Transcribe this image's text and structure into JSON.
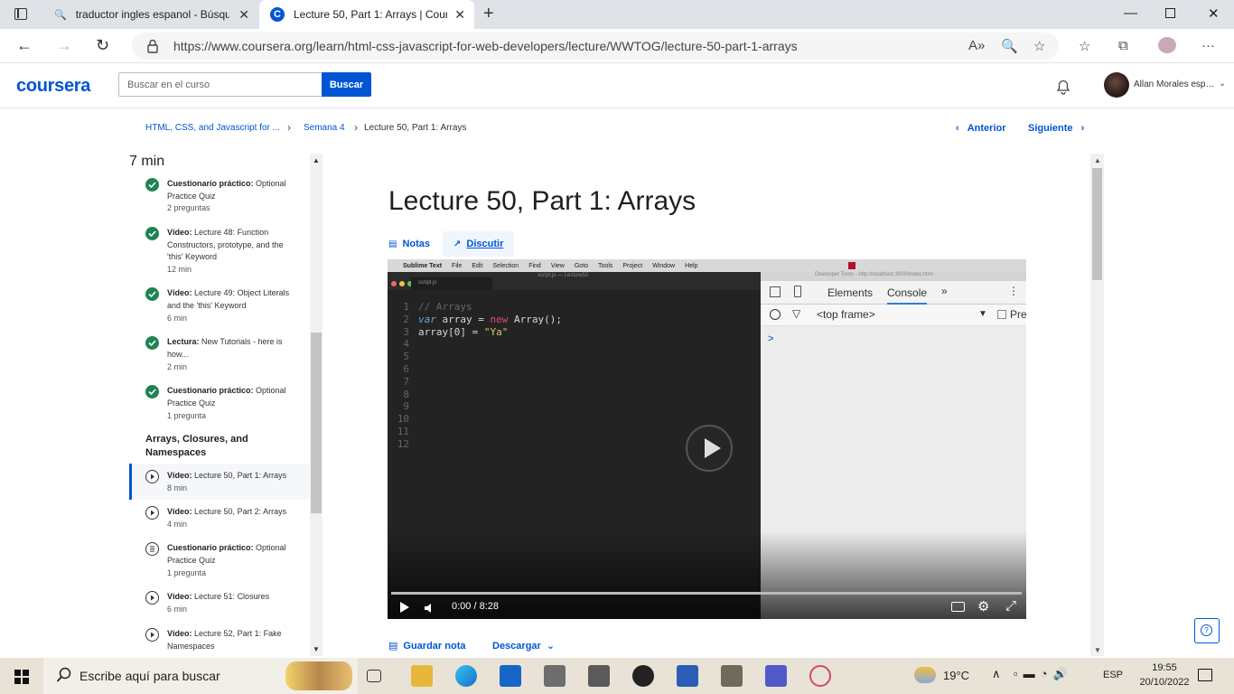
{
  "browser": {
    "tabs": [
      {
        "title": "traductor ingles espanol - Búsqu",
        "active": false
      },
      {
        "title": "Lecture 50, Part 1: Arrays | Cours",
        "active": true
      }
    ],
    "url": "https://www.coursera.org/learn/html-css-javascript-for-web-developers/lecture/WWTOG/lecture-50-part-1-arrays"
  },
  "header": {
    "logo": "coursera",
    "search_placeholder": "Buscar en el curso",
    "search_button": "Buscar",
    "user_name": "Allan Morales espi..."
  },
  "breadcrumb": {
    "items": [
      "HTML, CSS, and Javascript for ...",
      "Semana 4",
      "Lecture 50, Part 1: Arrays"
    ],
    "prev": "Anterior",
    "next": "Siguiente"
  },
  "sidebar": {
    "top_duration": "7 min",
    "items": [
      {
        "kind": "Cuestionario práctico:",
        "title": "Optional Practice Quiz",
        "meta": "2 preguntas",
        "status": "done"
      },
      {
        "kind": "Vídeo:",
        "title": "Lecture 48: Function Constructors, prototype, and the 'this' Keyword",
        "meta": "12 min",
        "status": "done"
      },
      {
        "kind": "Vídeo:",
        "title": "Lecture 49: Object Literals and the 'this' Keyword",
        "meta": "6 min",
        "status": "done"
      },
      {
        "kind": "Lectura:",
        "title": "New Tutorials - here is how...",
        "meta": "2 min",
        "status": "done"
      },
      {
        "kind": "Cuestionario práctico:",
        "title": "Optional Practice Quiz",
        "meta": "1 pregunta",
        "status": "done"
      }
    ],
    "section_title": "Arrays, Closures, and Namespaces",
    "section_items": [
      {
        "kind": "Vídeo:",
        "title": "Lecture 50, Part 1: Arrays",
        "meta": "8 min",
        "status": "current"
      },
      {
        "kind": "Vídeo:",
        "title": "Lecture 50, Part 2: Arrays",
        "meta": "4 min",
        "status": "video"
      },
      {
        "kind": "Cuestionario práctico:",
        "title": "Optional Practice Quiz",
        "meta": "1 pregunta",
        "status": "quiz"
      },
      {
        "kind": "Vídeo:",
        "title": "Lecture 51: Closures",
        "meta": "6 min",
        "status": "video"
      },
      {
        "kind": "Vídeo:",
        "title": "Lecture 52, Part 1: Fake Namespaces",
        "meta": "",
        "status": "video"
      }
    ]
  },
  "main": {
    "title": "Lecture 50, Part 1: Arrays",
    "tabs": {
      "notes": "Notas",
      "discuss": "Discutir"
    },
    "save_note": "Guardar nota",
    "download": "Descargar"
  },
  "video": {
    "mac_menu": [
      "Sublime Text",
      "File",
      "Edit",
      "Selection",
      "Find",
      "View",
      "Goto",
      "Tools",
      "Project",
      "Window",
      "Help"
    ],
    "window_title": "script.js — Lecture50",
    "editor_tab": "script.js",
    "line_numbers": [
      "1",
      "2",
      "3",
      "4",
      "5",
      "6",
      "7",
      "8",
      "9",
      "10",
      "11",
      "12"
    ],
    "devtools_title": "Developer Tools - http://localhost:3000/index.html",
    "devtools_tabs": [
      "Elements",
      "Console"
    ],
    "devtools_frame": "<top frame>",
    "devtools_preserve": "Pre",
    "console_prompt": ">",
    "time": "0:00 / 8:28",
    "progress": 0
  },
  "taskbar": {
    "search_placeholder": "Escribe aquí para buscar",
    "weather": "19°C",
    "lang": "ESP",
    "time": "19:55",
    "date": "20/10/2022"
  }
}
